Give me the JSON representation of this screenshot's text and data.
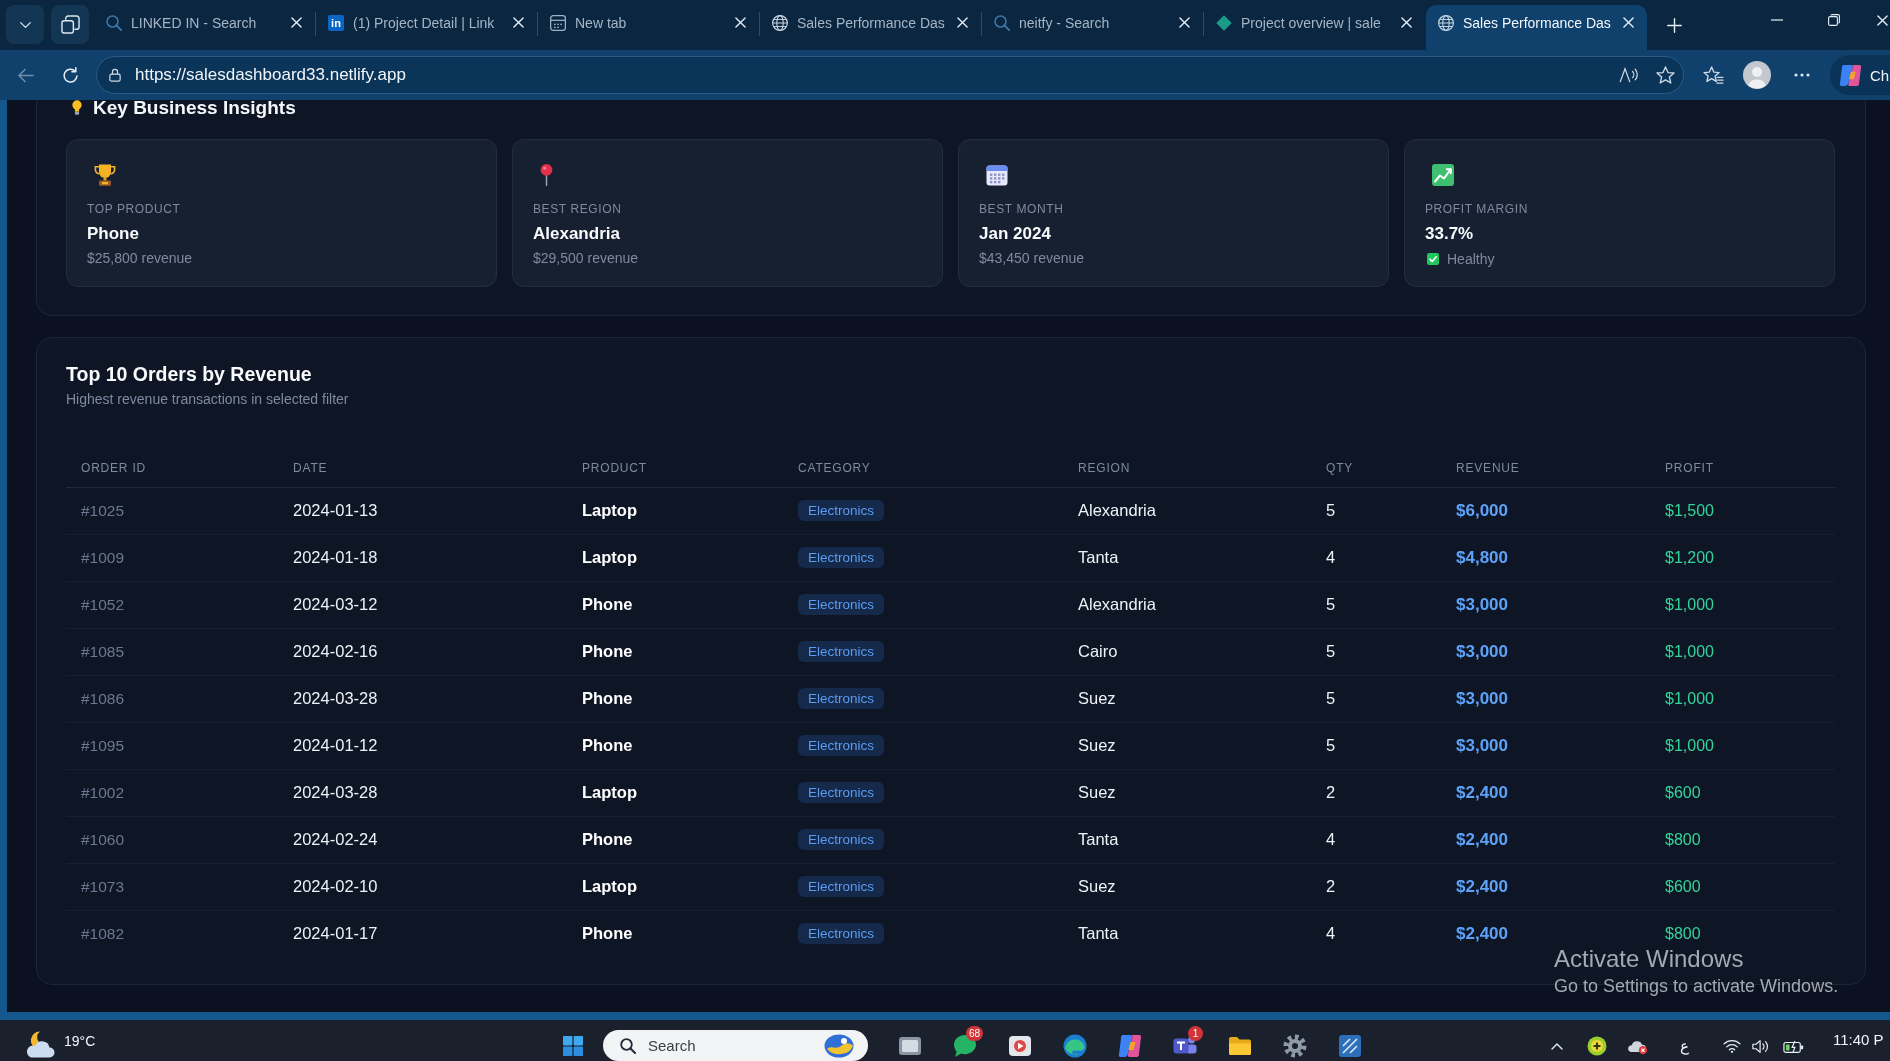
{
  "browser": {
    "tabs": [
      {
        "kind": "search",
        "title": "LINKED IN - Search",
        "selected": false
      },
      {
        "kind": "logo",
        "logo_text": "in",
        "title": "(1) Project Detail | Link",
        "selected": false
      },
      {
        "kind": "newtab",
        "title": "New tab",
        "selected": false
      },
      {
        "kind": "globe",
        "title": "Sales Performance Das",
        "selected": false
      },
      {
        "kind": "search",
        "title": "neitfy - Search",
        "selected": false
      },
      {
        "kind": "diamond",
        "title": "Project overview | sale",
        "selected": false
      },
      {
        "kind": "globe",
        "title": "Sales Performance Das",
        "selected": true
      }
    ],
    "address": "https://salesdashboard33.netlify.app",
    "copilot_label": "Ch"
  },
  "insights": {
    "title": "Key Business Insights",
    "cards": [
      {
        "kind": "trophy",
        "label": "TOP PRODUCT",
        "value": "Phone",
        "note": "$25,800 revenue"
      },
      {
        "kind": "pin",
        "label": "BEST REGION",
        "value": "Alexandria",
        "note": "$29,500 revenue"
      },
      {
        "kind": "calendar",
        "label": "BEST MONTH",
        "value": "Jan 2024",
        "note": "$43,450 revenue"
      },
      {
        "kind": "chart",
        "label": "PROFIT MARGIN",
        "value": "33.7%",
        "status": "Healthy"
      }
    ]
  },
  "orders": {
    "title": "Top 10 Orders by Revenue",
    "subtitle": "Highest revenue transactions in selected filter",
    "columns": [
      "ORDER ID",
      "DATE",
      "PRODUCT",
      "CATEGORY",
      "REGION",
      "QTY",
      "REVENUE",
      "PROFIT"
    ],
    "rows": [
      {
        "order_id": "#1025",
        "date": "2024-01-13",
        "product": "Laptop",
        "category": "Electronics",
        "region": "Alexandria",
        "qty": "5",
        "revenue": "$6,000",
        "profit": "$1,500"
      },
      {
        "order_id": "#1009",
        "date": "2024-01-18",
        "product": "Laptop",
        "category": "Electronics",
        "region": "Tanta",
        "qty": "4",
        "revenue": "$4,800",
        "profit": "$1,200"
      },
      {
        "order_id": "#1052",
        "date": "2024-03-12",
        "product": "Phone",
        "category": "Electronics",
        "region": "Alexandria",
        "qty": "5",
        "revenue": "$3,000",
        "profit": "$1,000"
      },
      {
        "order_id": "#1085",
        "date": "2024-02-16",
        "product": "Phone",
        "category": "Electronics",
        "region": "Cairo",
        "qty": "5",
        "revenue": "$3,000",
        "profit": "$1,000"
      },
      {
        "order_id": "#1086",
        "date": "2024-03-28",
        "product": "Phone",
        "category": "Electronics",
        "region": "Suez",
        "qty": "5",
        "revenue": "$3,000",
        "profit": "$1,000"
      },
      {
        "order_id": "#1095",
        "date": "2024-01-12",
        "product": "Phone",
        "category": "Electronics",
        "region": "Suez",
        "qty": "5",
        "revenue": "$3,000",
        "profit": "$1,000"
      },
      {
        "order_id": "#1002",
        "date": "2024-03-28",
        "product": "Laptop",
        "category": "Electronics",
        "region": "Suez",
        "qty": "2",
        "revenue": "$2,400",
        "profit": "$600"
      },
      {
        "order_id": "#1060",
        "date": "2024-02-24",
        "product": "Phone",
        "category": "Electronics",
        "region": "Tanta",
        "qty": "4",
        "revenue": "$2,400",
        "profit": "$800"
      },
      {
        "order_id": "#1073",
        "date": "2024-02-10",
        "product": "Laptop",
        "category": "Electronics",
        "region": "Suez",
        "qty": "2",
        "revenue": "$2,400",
        "profit": "$600"
      },
      {
        "order_id": "#1082",
        "date": "2024-01-17",
        "product": "Phone",
        "category": "Electronics",
        "region": "Tanta",
        "qty": "4",
        "revenue": "$2,400",
        "profit": "$800"
      }
    ]
  },
  "os_notice": {
    "title": "Activate Windows",
    "text": "Go to Settings to activate Windows."
  },
  "taskbar": {
    "temperature": "19°C",
    "search": {
      "placeholder": "Search"
    },
    "apps": [
      {
        "kind": "tile"
      },
      {
        "kind": "chat",
        "badge": "68"
      },
      {
        "kind": "media"
      },
      {
        "kind": "browser"
      },
      {
        "kind": "assistant"
      },
      {
        "kind": "people",
        "badge": "1"
      },
      {
        "kind": "folder"
      },
      {
        "kind": "gear"
      },
      {
        "kind": "remote"
      }
    ],
    "language": "ع",
    "time": "11:40 P"
  }
}
